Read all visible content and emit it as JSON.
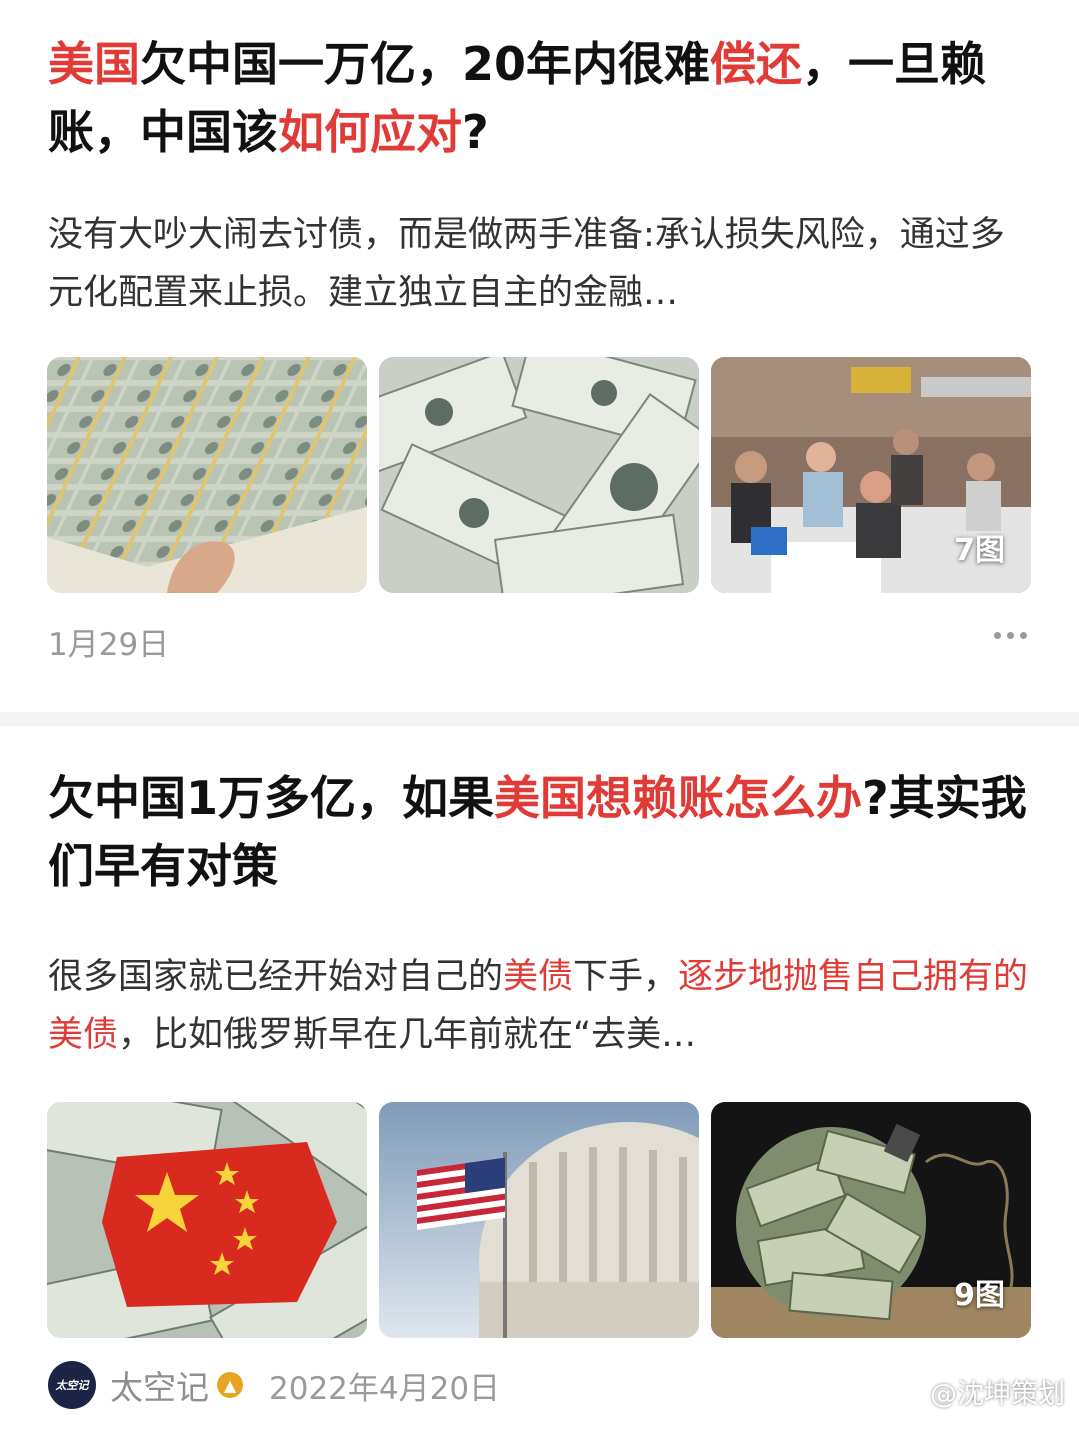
{
  "article1": {
    "title_parts": [
      {
        "text": "美国",
        "color": "red"
      },
      {
        "text": "欠中国一万亿，20年内很难",
        "color": "black"
      },
      {
        "text": "偿还",
        "color": "red"
      },
      {
        "text": "，一旦赖账，中国该",
        "color": "black"
      },
      {
        "text": "如何应对",
        "color": "red"
      },
      {
        "text": "?",
        "color": "black"
      }
    ],
    "summary": "没有大吵大闹去讨债，而是做两手准备:承认损失风险，通过多元化配置来止损。建立独立自主的金融…",
    "images": [
      "money-stack-image",
      "dollar-bills-image",
      "supermarket-checkout-image"
    ],
    "image_count": "7图",
    "date": "1月29日"
  },
  "article2": {
    "title_parts": [
      {
        "text": "欠中国1万多亿，如果",
        "color": "black"
      },
      {
        "text": "美国想赖账怎么办",
        "color": "red"
      },
      {
        "text": "?其实我们早有对策",
        "color": "black"
      }
    ],
    "summary_parts": [
      {
        "text": "很多国家就已经开始对自己的",
        "color": "gray"
      },
      {
        "text": "美债",
        "color": "red"
      },
      {
        "text": "下手，",
        "color": "gray"
      },
      {
        "text": "逐步地抛售自己拥有的美债",
        "color": "red"
      },
      {
        "text": "，比如俄罗斯早在几年前就在“去美…",
        "color": "gray"
      }
    ],
    "images": [
      "china-flag-money-image",
      "us-capitol-flag-image",
      "money-bomb-image"
    ],
    "image_count": "9图",
    "author": "太空记",
    "avatar_text": "太空记",
    "date": "2022年4月20日"
  },
  "watermark": "@沈坤策划",
  "colors": {
    "accent_red": "#e03b36",
    "text": "#111111",
    "meta_gray": "#9a9a9a"
  }
}
